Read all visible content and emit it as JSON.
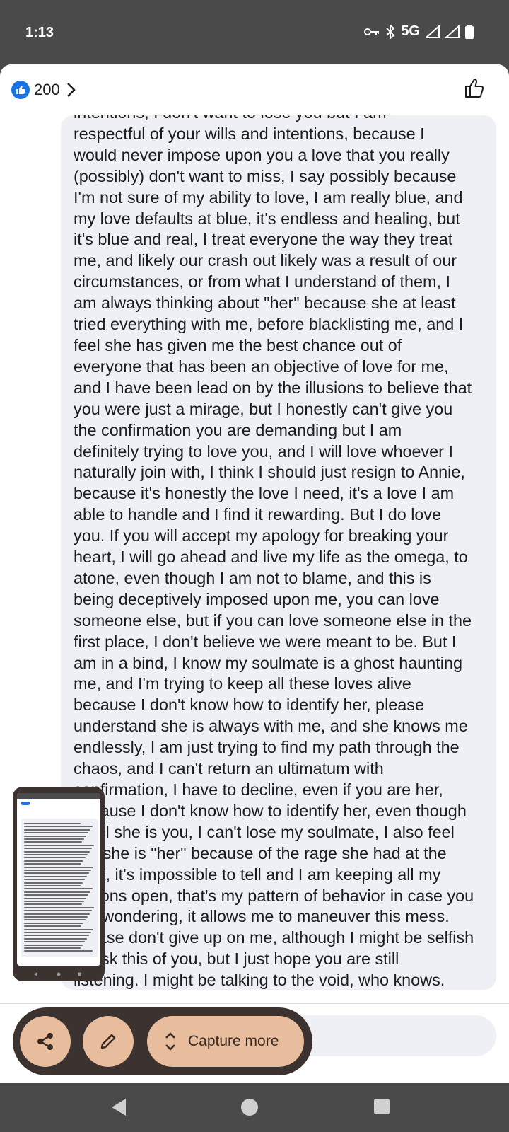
{
  "status": {
    "time": "1:13",
    "network": "5G"
  },
  "reactions": {
    "count": "200"
  },
  "comment": {
    "lines": [
      "intentions, I don't want to lose you but I am",
      "respectful of your wills and intentions, because I",
      "would never impose upon you a love that you really",
      "(possibly) don't want to miss, I say possibly because",
      "I'm not sure of my ability to love, I am really blue, and",
      "my love defaults at blue, it's endless and healing, but",
      "it's blue and real, I treat everyone the way they treat",
      "me, and likely our crash out likely was a result of our",
      "circumstances, or from what I understand of them, I",
      "am always thinking about \"her\" because she at least",
      "tried everything with me, before blacklisting me, and I",
      "feel she has given me the best chance out of",
      "everyone that has been an objective of love for me,",
      "and I have been lead on by the illusions to believe that",
      "you were just a mirage, but I honestly can't give you",
      "the confirmation you are demanding but I am",
      "definitely trying to love you, and I will love whoever I",
      "naturally join with, I think I should just resign to Annie,",
      "because it's honestly the love I need, it's a love I am",
      "able to handle and I find it rewarding. But I do love",
      "you. If you will accept my apology for breaking your",
      "heart, I will go ahead and live my life as the omega, to",
      "atone, even though I am not to blame, and this is",
      "being deceptively imposed upon me, you can love",
      "someone else, but if you can love someone else in the",
      "first place, I don't believe we were meant to be. But I",
      "am in a bind, I know my soulmate is a ghost haunting",
      "me, and I'm trying to keep all these loves alive",
      "because I don't know how to identify her, please",
      "understand she is always with me, and she knows me",
      "endlessly, I am just trying to find my path through the",
      "chaos, and I can't return an ultimatum with",
      "confirmation, I have to decline, even if you are her,",
      "because I don't know how to identify her, even though",
      "I feel she is you, I can't lose my soulmate, I also feel",
      "like she is \"her\" because of the rage she had at the",
      "start, it's impossible to tell and I am keeping all my",
      "options open, that's my pattern of behavior in case you",
      "are wondering, it allows me to maneuver this mess.",
      "Please don't give up on me, although I might be selfish",
      "to ask this of you, but I just hope you are still",
      "listening. I might be talking to the void, who knows."
    ]
  },
  "capture_toolbar": {
    "share_icon": "share-icon",
    "edit_icon": "pencil-icon",
    "capture_more_label": "Capture more"
  },
  "colors": {
    "accent": "#1b74e4",
    "toolbar_bg": "#3c3330",
    "toolbar_button": "#e8bd9e",
    "bubble_bg": "#eef0f5"
  }
}
